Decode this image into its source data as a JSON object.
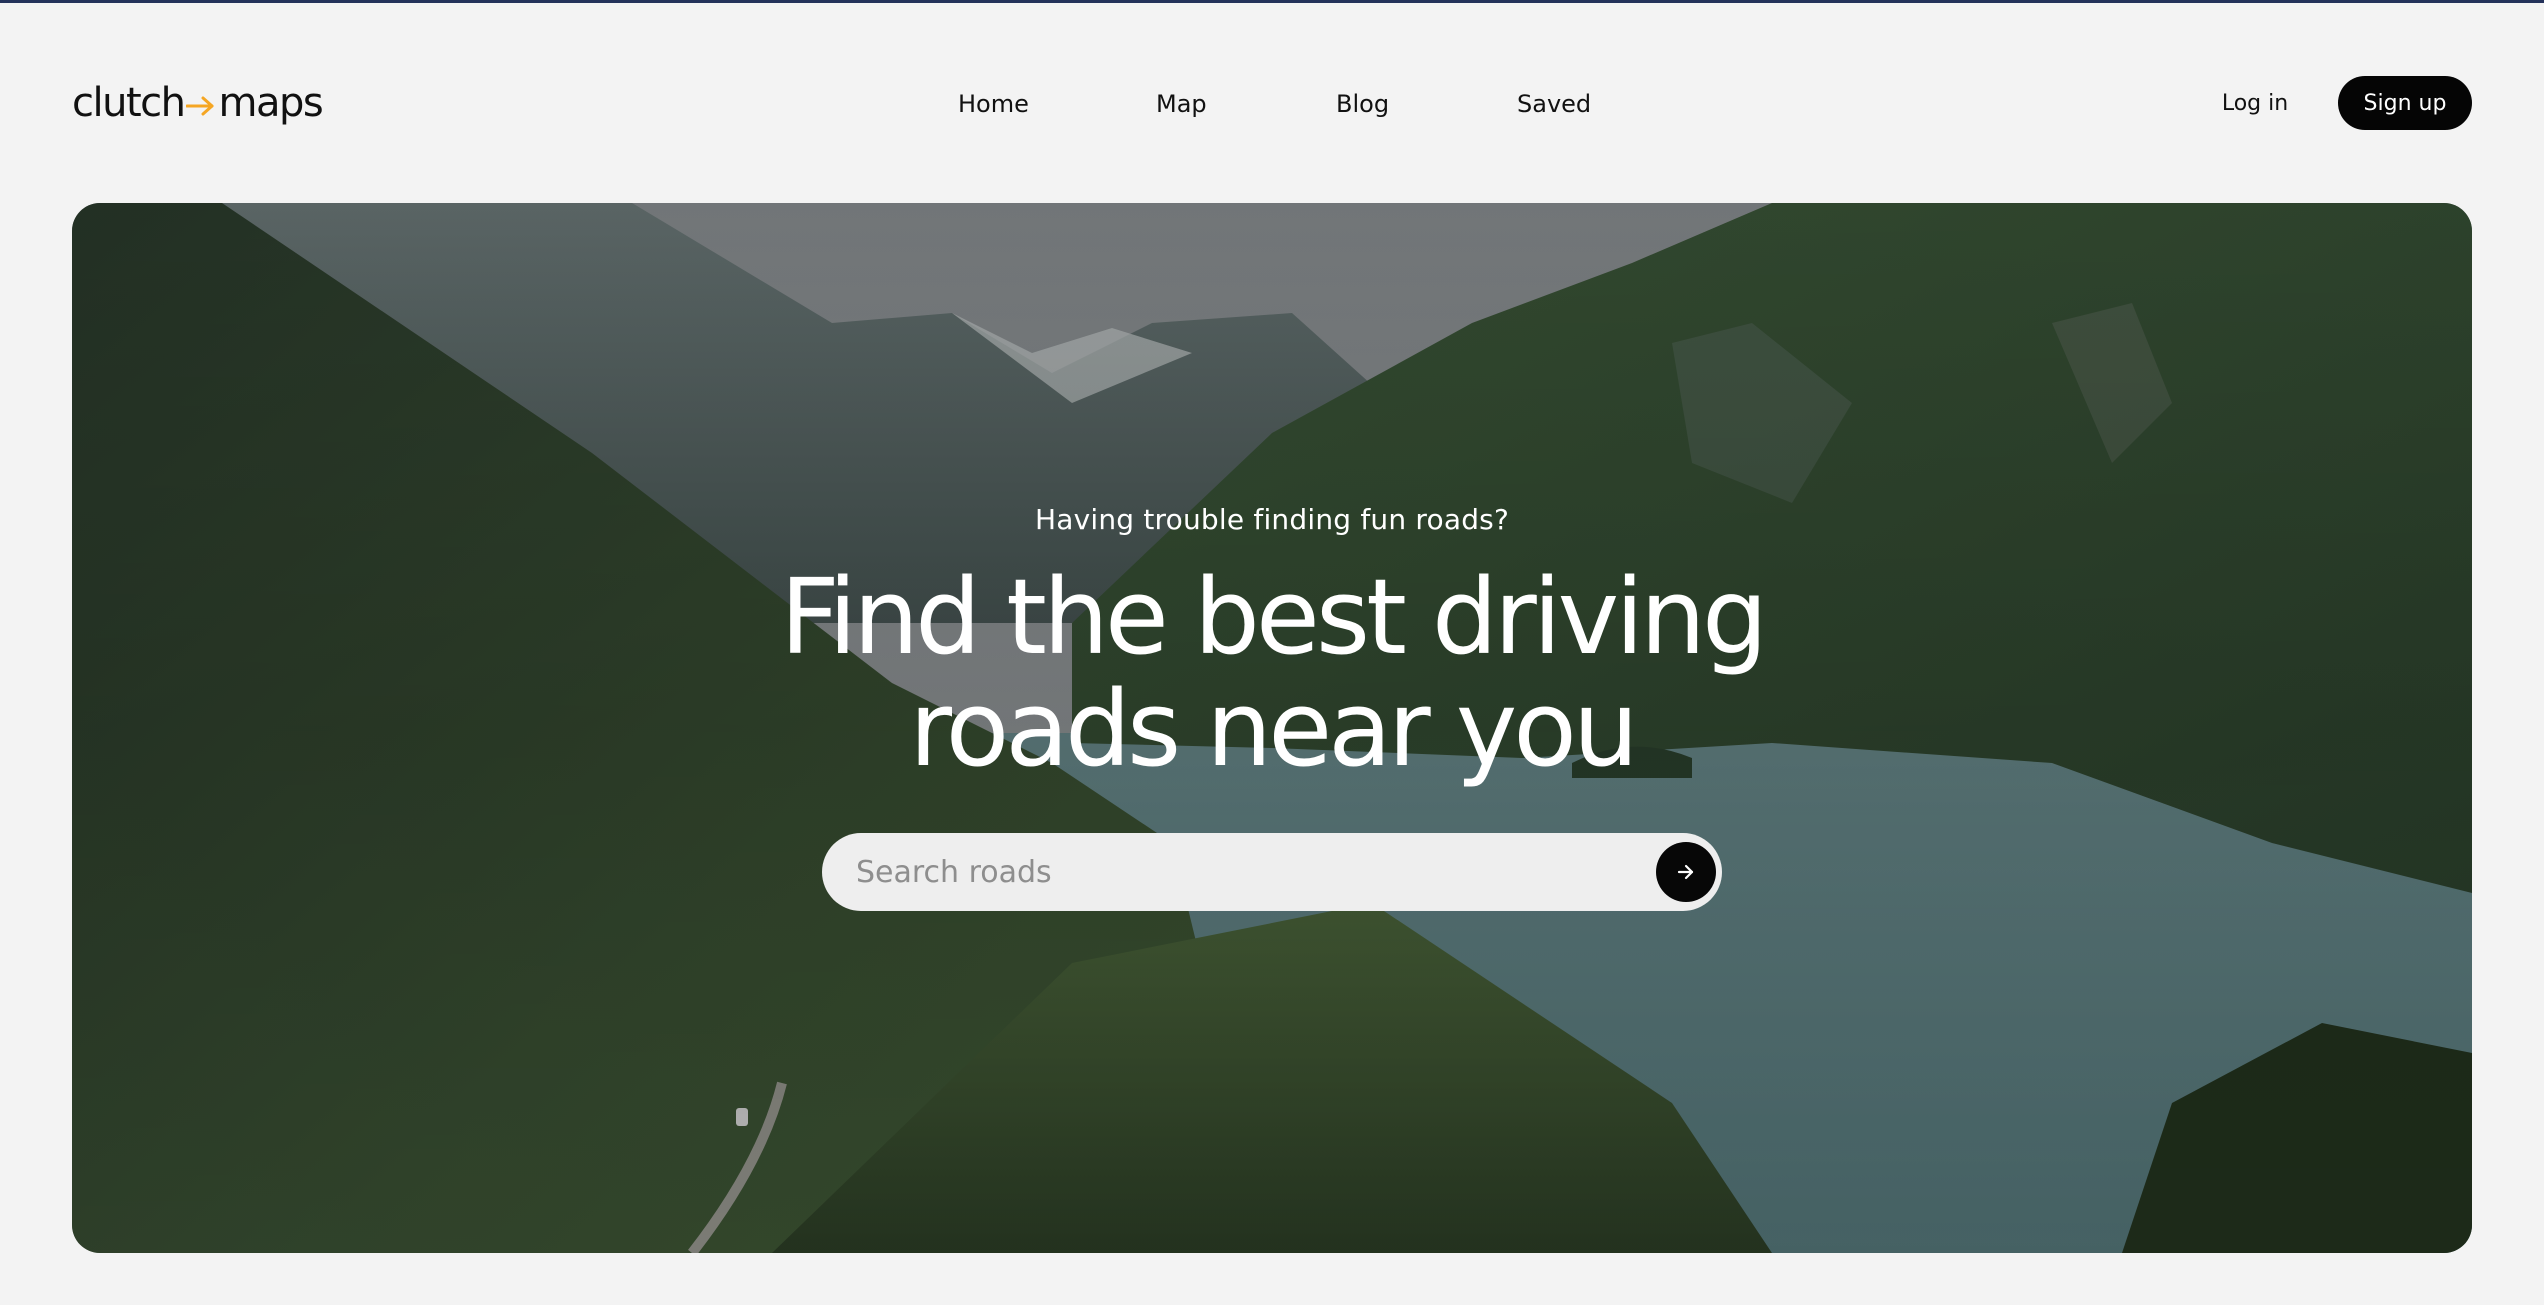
{
  "brand": {
    "name_left": "clutch",
    "name_right": "maps",
    "accent_color": "#f5a623",
    "logo_icon": "arrow-right-icon"
  },
  "nav": {
    "items": [
      {
        "label": "Home"
      },
      {
        "label": "Map"
      },
      {
        "label": "Blog"
      },
      {
        "label": "Saved"
      }
    ]
  },
  "auth": {
    "login_label": "Log in",
    "signup_label": "Sign up"
  },
  "hero": {
    "eyebrow": "Having trouble finding fun roads?",
    "headline_line1": "Find the best driving",
    "headline_line2": "roads near you",
    "search": {
      "placeholder": "Search roads",
      "value": "",
      "button_icon": "arrow-right-icon"
    },
    "background": "mountain lake forest landscape photo"
  },
  "colors": {
    "page_background": "#f3f3f3",
    "button_dark": "#050505",
    "text_light": "#ffffff"
  }
}
